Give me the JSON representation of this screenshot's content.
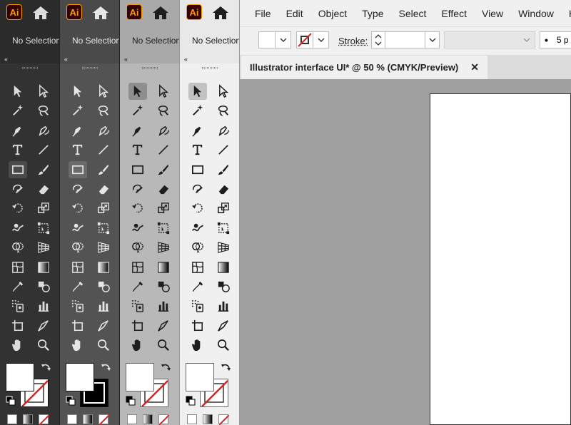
{
  "app": {
    "logo": "Ai",
    "home_icon": "home-icon"
  },
  "menu": [
    "File",
    "Edit",
    "Object",
    "Type",
    "Select",
    "Effect",
    "View",
    "Window",
    "Help"
  ],
  "control_bar": {
    "selection_text": "No Selection",
    "stroke_label": "Stroke:",
    "brush_dot": "•",
    "brush_value": "5 p"
  },
  "panel": {
    "collapse_icon": "«"
  },
  "document_tab": {
    "title": "Illustrator interface UI* @ 50 % (CMYK/Preview)",
    "close": "✕"
  },
  "themes": [
    {
      "name": "darkest",
      "bg": "#323232",
      "fg": "#dddddd",
      "top": "#2b2b2b",
      "sel": "#4a4a4a"
    },
    {
      "name": "dark",
      "bg": "#535353",
      "fg": "#e6e6e6",
      "top": "#4a4a4a",
      "sel": "#6a6a6a"
    },
    {
      "name": "medium",
      "bg": "#b8b8b8",
      "fg": "#1e1e1e",
      "top": "#a9a9a9",
      "sel": "#8f8f8f"
    },
    {
      "name": "light",
      "bg": "#f0f0f0",
      "fg": "#1e1e1e",
      "top": "#e8e8e8",
      "sel": "#c2c2c2"
    }
  ],
  "tools": [
    [
      "selection-tool",
      "direct-selection-tool"
    ],
    [
      "magic-wand-tool",
      "lasso-tool"
    ],
    [
      "pen-tool",
      "curvature-tool"
    ],
    [
      "type-tool",
      "line-segment-tool"
    ],
    [
      "rectangle-tool",
      "paintbrush-tool"
    ],
    [
      "shaper-tool",
      "eraser-tool"
    ],
    [
      "rotate-tool",
      "scale-tool"
    ],
    [
      "warp-tool",
      "free-transform-tool"
    ],
    [
      "shape-builder-tool",
      "perspective-grid-tool"
    ],
    [
      "mesh-tool",
      "gradient-tool"
    ],
    [
      "eyedropper-tool",
      "blend-tool"
    ],
    [
      "symbol-sprayer-tool",
      "column-graph-tool"
    ],
    [
      "artboard-tool",
      "slice-tool"
    ],
    [
      "hand-tool",
      "zoom-tool"
    ]
  ]
}
